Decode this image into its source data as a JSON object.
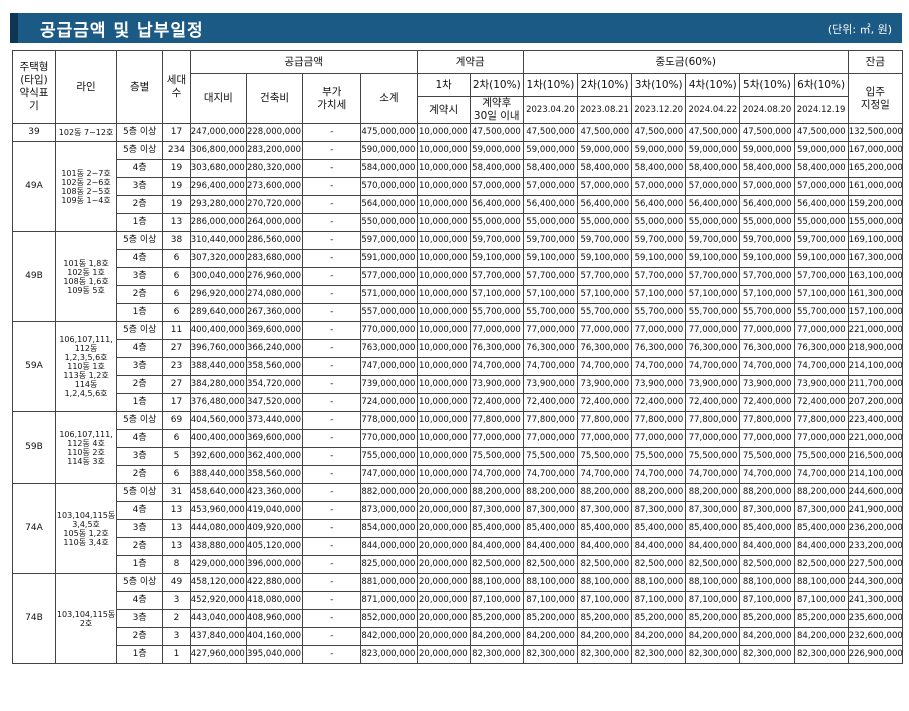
{
  "header": {
    "title": "공급금액 및 납부일정",
    "unit": "(단위: ㎡, 원)"
  },
  "columns": {
    "type_lines": [
      "주택형",
      "(타입)",
      "약식표",
      "기"
    ],
    "line": "라인",
    "floor": "층별",
    "units": [
      "세대",
      "수"
    ],
    "supply_price": "공급금액",
    "land": "대지비",
    "building": "건축비",
    "vat": [
      "부가",
      "가치세"
    ],
    "subtotal": "소계",
    "deposit": "계약금",
    "dep1": "1차",
    "dep2": "2차(10%)",
    "dep1_when": "계약시",
    "dep2_when": [
      "계약후",
      "30일 이내"
    ],
    "middle": "중도금(60%)",
    "mid_labels": [
      "1차(10%)",
      "2차(10%)",
      "3차(10%)",
      "4차(10%)",
      "5차(10%)",
      "6차(10%)"
    ],
    "mid_dates": [
      "2023.04.20",
      "2023.08.21",
      "2023.12.20",
      "2024.04.22",
      "2024.08.20",
      "2024.12.19"
    ],
    "balance": "잔금",
    "balance_when": [
      "입주",
      "지정일"
    ]
  },
  "groups": [
    {
      "type": "39",
      "line": [
        "102동 7~12호"
      ],
      "rows": [
        [
          "5층 이상",
          "17",
          "247,000,000",
          "228,000,000",
          "-",
          "475,000,000",
          "10,000,000",
          "47,500,000",
          "47,500,000",
          "47,500,000",
          "47,500,000",
          "47,500,000",
          "47,500,000",
          "47,500,000",
          "132,500,000"
        ]
      ]
    },
    {
      "type": "49A",
      "line": [
        "101동 2~7호",
        "102동 2~6호",
        "108동 2~5호",
        "109동 1~4호"
      ],
      "rows": [
        [
          "5층 이상",
          "234",
          "306,800,000",
          "283,200,000",
          "-",
          "590,000,000",
          "10,000,000",
          "59,000,000",
          "59,000,000",
          "59,000,000",
          "59,000,000",
          "59,000,000",
          "59,000,000",
          "59,000,000",
          "167,000,000"
        ],
        [
          "4층",
          "19",
          "303,680,000",
          "280,320,000",
          "-",
          "584,000,000",
          "10,000,000",
          "58,400,000",
          "58,400,000",
          "58,400,000",
          "58,400,000",
          "58,400,000",
          "58,400,000",
          "58,400,000",
          "165,200,000"
        ],
        [
          "3층",
          "19",
          "296,400,000",
          "273,600,000",
          "-",
          "570,000,000",
          "10,000,000",
          "57,000,000",
          "57,000,000",
          "57,000,000",
          "57,000,000",
          "57,000,000",
          "57,000,000",
          "57,000,000",
          "161,000,000"
        ],
        [
          "2층",
          "19",
          "293,280,000",
          "270,720,000",
          "-",
          "564,000,000",
          "10,000,000",
          "56,400,000",
          "56,400,000",
          "56,400,000",
          "56,400,000",
          "56,400,000",
          "56,400,000",
          "56,400,000",
          "159,200,000"
        ],
        [
          "1층",
          "13",
          "286,000,000",
          "264,000,000",
          "-",
          "550,000,000",
          "10,000,000",
          "55,000,000",
          "55,000,000",
          "55,000,000",
          "55,000,000",
          "55,000,000",
          "55,000,000",
          "55,000,000",
          "155,000,000"
        ]
      ]
    },
    {
      "type": "49B",
      "line": [
        "101동 1,8호",
        "102동 1호",
        "108동 1,6호",
        "109동 5호"
      ],
      "rows": [
        [
          "5층 이상",
          "38",
          "310,440,000",
          "286,560,000",
          "-",
          "597,000,000",
          "10,000,000",
          "59,700,000",
          "59,700,000",
          "59,700,000",
          "59,700,000",
          "59,700,000",
          "59,700,000",
          "59,700,000",
          "169,100,000"
        ],
        [
          "4층",
          "6",
          "307,320,000",
          "283,680,000",
          "-",
          "591,000,000",
          "10,000,000",
          "59,100,000",
          "59,100,000",
          "59,100,000",
          "59,100,000",
          "59,100,000",
          "59,100,000",
          "59,100,000",
          "167,300,000"
        ],
        [
          "3층",
          "6",
          "300,040,000",
          "276,960,000",
          "-",
          "577,000,000",
          "10,000,000",
          "57,700,000",
          "57,700,000",
          "57,700,000",
          "57,700,000",
          "57,700,000",
          "57,700,000",
          "57,700,000",
          "163,100,000"
        ],
        [
          "2층",
          "6",
          "296,920,000",
          "274,080,000",
          "-",
          "571,000,000",
          "10,000,000",
          "57,100,000",
          "57,100,000",
          "57,100,000",
          "57,100,000",
          "57,100,000",
          "57,100,000",
          "57,100,000",
          "161,300,000"
        ],
        [
          "1층",
          "6",
          "289,640,000",
          "267,360,000",
          "-",
          "557,000,000",
          "10,000,000",
          "55,700,000",
          "55,700,000",
          "55,700,000",
          "55,700,000",
          "55,700,000",
          "55,700,000",
          "55,700,000",
          "157,100,000"
        ]
      ]
    },
    {
      "type": "59A",
      "line": [
        "106,107,111,",
        "112동",
        "1,2,3,5,6호",
        "110동 1호",
        "113동 1,2호",
        "114동",
        "1,2,4,5,6호"
      ],
      "rows": [
        [
          "5층 이상",
          "11",
          "400,400,000",
          "369,600,000",
          "-",
          "770,000,000",
          "10,000,000",
          "77,000,000",
          "77,000,000",
          "77,000,000",
          "77,000,000",
          "77,000,000",
          "77,000,000",
          "77,000,000",
          "221,000,000"
        ],
        [
          "4층",
          "27",
          "396,760,000",
          "366,240,000",
          "-",
          "763,000,000",
          "10,000,000",
          "76,300,000",
          "76,300,000",
          "76,300,000",
          "76,300,000",
          "76,300,000",
          "76,300,000",
          "76,300,000",
          "218,900,000"
        ],
        [
          "3층",
          "23",
          "388,440,000",
          "358,560,000",
          "-",
          "747,000,000",
          "10,000,000",
          "74,700,000",
          "74,700,000",
          "74,700,000",
          "74,700,000",
          "74,700,000",
          "74,700,000",
          "74,700,000",
          "214,100,000"
        ],
        [
          "2층",
          "27",
          "384,280,000",
          "354,720,000",
          "-",
          "739,000,000",
          "10,000,000",
          "73,900,000",
          "73,900,000",
          "73,900,000",
          "73,900,000",
          "73,900,000",
          "73,900,000",
          "73,900,000",
          "211,700,000"
        ],
        [
          "1층",
          "17",
          "376,480,000",
          "347,520,000",
          "-",
          "724,000,000",
          "10,000,000",
          "72,400,000",
          "72,400,000",
          "72,400,000",
          "72,400,000",
          "72,400,000",
          "72,400,000",
          "72,400,000",
          "207,200,000"
        ]
      ]
    },
    {
      "type": "59B",
      "line": [
        "106,107,111,",
        "112동 4호",
        "110동 2호",
        "114동 3호"
      ],
      "rows": [
        [
          "5층 이상",
          "69",
          "404,560,000",
          "373,440,000",
          "-",
          "778,000,000",
          "10,000,000",
          "77,800,000",
          "77,800,000",
          "77,800,000",
          "77,800,000",
          "77,800,000",
          "77,800,000",
          "77,800,000",
          "223,400,000"
        ],
        [
          "4층",
          "6",
          "400,400,000",
          "369,600,000",
          "-",
          "770,000,000",
          "10,000,000",
          "77,000,000",
          "77,000,000",
          "77,000,000",
          "77,000,000",
          "77,000,000",
          "77,000,000",
          "77,000,000",
          "221,000,000"
        ],
        [
          "3층",
          "5",
          "392,600,000",
          "362,400,000",
          "-",
          "755,000,000",
          "10,000,000",
          "75,500,000",
          "75,500,000",
          "75,500,000",
          "75,500,000",
          "75,500,000",
          "75,500,000",
          "75,500,000",
          "216,500,000"
        ],
        [
          "2층",
          "6",
          "388,440,000",
          "358,560,000",
          "-",
          "747,000,000",
          "10,000,000",
          "74,700,000",
          "74,700,000",
          "74,700,000",
          "74,700,000",
          "74,700,000",
          "74,700,000",
          "74,700,000",
          "214,100,000"
        ]
      ]
    },
    {
      "type": "74A",
      "line": [
        "103,104,115동",
        "3,4,5호",
        "105동 1,2호",
        "110동 3,4호"
      ],
      "rows": [
        [
          "5층 이상",
          "31",
          "458,640,000",
          "423,360,000",
          "-",
          "882,000,000",
          "20,000,000",
          "88,200,000",
          "88,200,000",
          "88,200,000",
          "88,200,000",
          "88,200,000",
          "88,200,000",
          "88,200,000",
          "244,600,000"
        ],
        [
          "4층",
          "13",
          "453,960,000",
          "419,040,000",
          "-",
          "873,000,000",
          "20,000,000",
          "87,300,000",
          "87,300,000",
          "87,300,000",
          "87,300,000",
          "87,300,000",
          "87,300,000",
          "87,300,000",
          "241,900,000"
        ],
        [
          "3층",
          "13",
          "444,080,000",
          "409,920,000",
          "-",
          "854,000,000",
          "20,000,000",
          "85,400,000",
          "85,400,000",
          "85,400,000",
          "85,400,000",
          "85,400,000",
          "85,400,000",
          "85,400,000",
          "236,200,000"
        ],
        [
          "2층",
          "13",
          "438,880,000",
          "405,120,000",
          "-",
          "844,000,000",
          "20,000,000",
          "84,400,000",
          "84,400,000",
          "84,400,000",
          "84,400,000",
          "84,400,000",
          "84,400,000",
          "84,400,000",
          "233,200,000"
        ],
        [
          "1층",
          "8",
          "429,000,000",
          "396,000,000",
          "-",
          "825,000,000",
          "20,000,000",
          "82,500,000",
          "82,500,000",
          "82,500,000",
          "82,500,000",
          "82,500,000",
          "82,500,000",
          "82,500,000",
          "227,500,000"
        ]
      ]
    },
    {
      "type": "74B",
      "line": [
        "103,104,115동",
        "2호"
      ],
      "rows": [
        [
          "5층 이상",
          "49",
          "458,120,000",
          "422,880,000",
          "-",
          "881,000,000",
          "20,000,000",
          "88,100,000",
          "88,100,000",
          "88,100,000",
          "88,100,000",
          "88,100,000",
          "88,100,000",
          "88,100,000",
          "244,300,000"
        ],
        [
          "4층",
          "3",
          "452,920,000",
          "418,080,000",
          "-",
          "871,000,000",
          "20,000,000",
          "87,100,000",
          "87,100,000",
          "87,100,000",
          "87,100,000",
          "87,100,000",
          "87,100,000",
          "87,100,000",
          "241,300,000"
        ],
        [
          "3층",
          "2",
          "443,040,000",
          "408,960,000",
          "-",
          "852,000,000",
          "20,000,000",
          "85,200,000",
          "85,200,000",
          "85,200,000",
          "85,200,000",
          "85,200,000",
          "85,200,000",
          "85,200,000",
          "235,600,000"
        ],
        [
          "2층",
          "3",
          "437,840,000",
          "404,160,000",
          "-",
          "842,000,000",
          "20,000,000",
          "84,200,000",
          "84,200,000",
          "84,200,000",
          "84,200,000",
          "84,200,000",
          "84,200,000",
          "84,200,000",
          "232,600,000"
        ],
        [
          "1층",
          "1",
          "427,960,000",
          "395,040,000",
          "-",
          "823,000,000",
          "20,000,000",
          "82,300,000",
          "82,300,000",
          "82,300,000",
          "82,300,000",
          "82,300,000",
          "82,300,000",
          "82,300,000",
          "226,900,000"
        ]
      ]
    }
  ]
}
